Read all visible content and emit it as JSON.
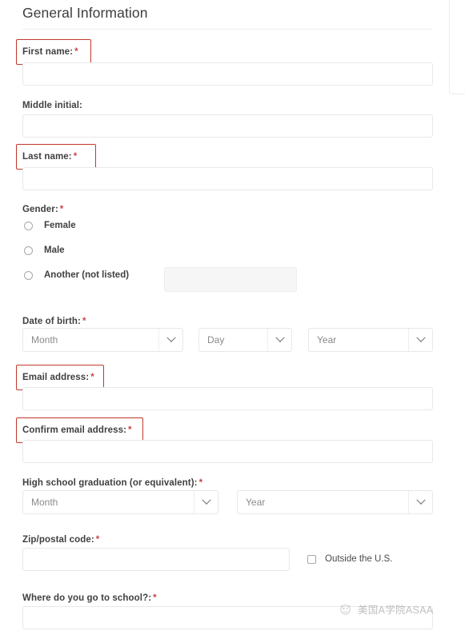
{
  "form": {
    "section_title": "General Information",
    "required_marker": "*",
    "fields": {
      "first_name": {
        "label": "First name:",
        "required": true,
        "value": "",
        "annotated": true
      },
      "middle_initial": {
        "label": "Middle initial:",
        "required": false,
        "value": "",
        "annotated": false
      },
      "last_name": {
        "label": "Last name:",
        "required": true,
        "value": "",
        "annotated": true
      },
      "gender": {
        "label": "Gender:",
        "required": true,
        "options": [
          {
            "label": "Female",
            "selected": false
          },
          {
            "label": "Male",
            "selected": false
          },
          {
            "label": "Another (not listed)",
            "selected": false
          }
        ],
        "other_value": ""
      },
      "date_of_birth": {
        "label": "Date of birth:",
        "required": true,
        "month": "Month",
        "day": "Day",
        "year": "Year"
      },
      "email": {
        "label": "Email address:",
        "required": true,
        "value": "",
        "annotated": true
      },
      "confirm_email": {
        "label": "Confirm email address:",
        "required": true,
        "value": "",
        "annotated": true
      },
      "hs_graduation": {
        "label": "High school graduation (or equivalent):",
        "required": true,
        "month": "Month",
        "year": "Year"
      },
      "zip": {
        "label": "Zip/postal code:",
        "required": true,
        "value": "",
        "outside_us_label": "Outside the U.S.",
        "outside_us_checked": false
      },
      "school": {
        "label": "Where do you go to school?:",
        "required": true,
        "value": ""
      }
    }
  },
  "watermark": {
    "text": "美国A学院ASAA",
    "icon": "circle-logo-icon"
  },
  "colors": {
    "annotation_red": "#c0392b",
    "required_red": "#cc4444",
    "label_text": "#404040",
    "title_text": "#3c3c3c",
    "input_border": "#e8e8e8",
    "placeholder": "#8a8a8a"
  }
}
